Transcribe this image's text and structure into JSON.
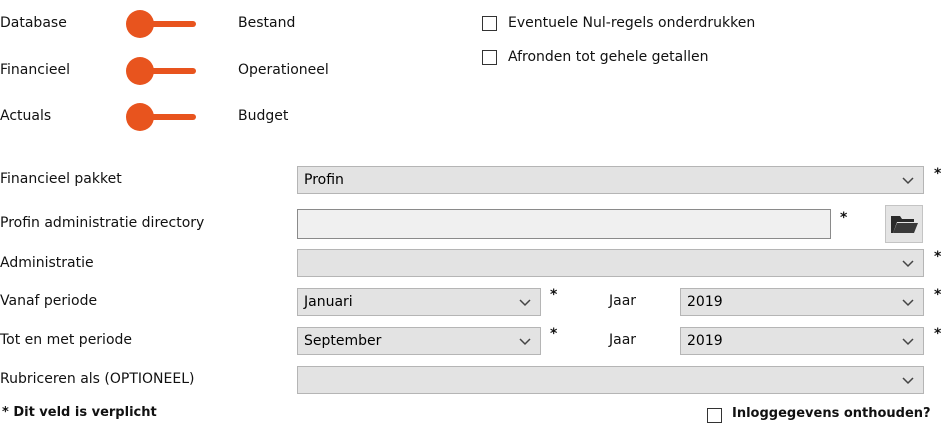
{
  "toggles": [
    {
      "left": "Database",
      "right": "Bestand"
    },
    {
      "left": "Financieel",
      "right": "Operationeel"
    },
    {
      "left": "Actuals",
      "right": "Budget"
    }
  ],
  "options": {
    "suppress_zero_label": "Eventuele Nul-regels onderdrukken",
    "round_label": "Afronden tot gehele getallen"
  },
  "form": {
    "package_label": "Financieel pakket",
    "package_value": "Profin",
    "directory_label": "Profin administratie directory",
    "directory_value": "",
    "administration_label": "Administratie",
    "administration_value": "",
    "from_period_label": "Vanaf periode",
    "from_period_value": "Januari",
    "year_label": "Jaar",
    "from_year_value": "2019",
    "to_period_label": "Tot en met periode",
    "to_period_value": "September",
    "to_year_value": "2019",
    "classify_label": "Rubriceren als (OPTIONEEL)",
    "classify_value": "",
    "required_marker": "*"
  },
  "footer": {
    "required_note": "* Dit veld is verplicht",
    "remember_label": "Inloggegevens onthouden?"
  },
  "colors": {
    "accent": "#e8541e"
  },
  "icons": {
    "folder": "folder-icon",
    "chevron": "chevron-down-icon"
  }
}
